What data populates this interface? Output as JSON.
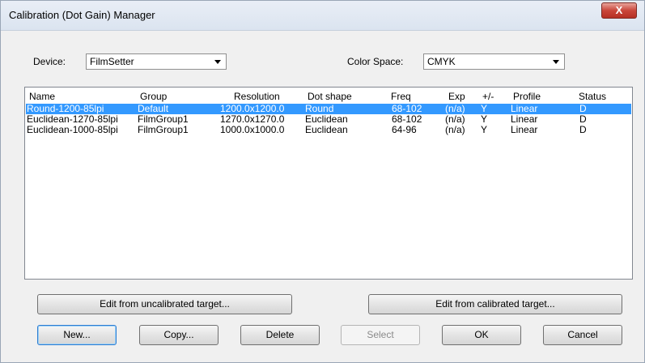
{
  "window": {
    "title": "Calibration (Dot Gain) Manager",
    "close_glyph": "X"
  },
  "device": {
    "label": "Device:",
    "value": "FilmSetter"
  },
  "color_space": {
    "label": "Color Space:",
    "value": "CMYK"
  },
  "table": {
    "columns": [
      "Name",
      "Group",
      "Resolution",
      "Dot shape",
      "Freq",
      "Exp",
      "+/-",
      "Profile",
      "Status"
    ],
    "rows": [
      [
        "Round-1200-85lpi",
        "Default",
        "1200.0x1200.0",
        "Round",
        "68-102",
        "(n/a)",
        "Y",
        "Linear",
        "D"
      ],
      [
        "Euclidean-1270-85lpi",
        "FilmGroup1",
        "1270.0x1270.0",
        "Euclidean",
        "68-102",
        "(n/a)",
        "Y",
        "Linear",
        "D"
      ],
      [
        "Euclidean-1000-85lpi",
        "FilmGroup1",
        "1000.0x1000.0",
        "Euclidean",
        "64-96",
        "(n/a)",
        "Y",
        "Linear",
        "D"
      ]
    ],
    "selected_row": 0
  },
  "buttons": {
    "edit_uncalibrated": "Edit from uncalibrated target...",
    "edit_calibrated": "Edit from calibrated target...",
    "new": "New...",
    "copy": "Copy...",
    "delete": "Delete",
    "select": "Select",
    "ok": "OK",
    "cancel": "Cancel"
  },
  "colors": {
    "selection": "#3399ff"
  }
}
